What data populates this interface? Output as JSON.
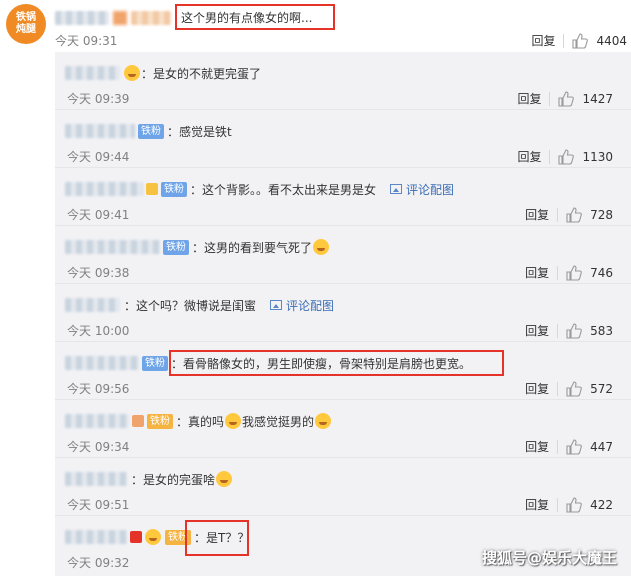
{
  "main_comment": {
    "avatar_text_line1": "铁锅",
    "avatar_text_line2": "炖腿",
    "text": "这个男的有点像女的啊...",
    "time": "今天 09:31",
    "reply_label": "回复",
    "likes": "4404"
  },
  "replies": [
    {
      "badge": "",
      "text": "是女的不就更完蛋了",
      "time": "今天 09:39",
      "reply_label": "回复",
      "likes": "1427"
    },
    {
      "badge": "铁粉",
      "text": "感觉是铁t",
      "time": "今天 09:44",
      "reply_label": "回复",
      "likes": "1130"
    },
    {
      "badge": "铁粉",
      "text": "这个背影。。看不太出来是男是女",
      "pic_link": "评论配图",
      "time": "今天 09:41",
      "reply_label": "回复",
      "likes": "728"
    },
    {
      "badge": "铁粉",
      "text": "这男的看到要气死了",
      "time": "今天 09:38",
      "reply_label": "回复",
      "likes": "746"
    },
    {
      "badge": "",
      "text": "这个吗？微博说是闺蜜",
      "pic_link": "评论配图",
      "time": "今天 10:00",
      "reply_label": "回复",
      "likes": "583"
    },
    {
      "badge": "铁粉",
      "text": "看骨骼像女的，男生即使瘦，骨架特别是肩膀也更宽。",
      "time": "今天 09:56",
      "reply_label": "回复",
      "likes": "572"
    },
    {
      "badge": "铁粉",
      "text_a": "真的吗",
      "text_b": "我感觉挺男的",
      "time": "今天 09:34",
      "reply_label": "回复",
      "likes": "447"
    },
    {
      "badge": "",
      "text": "是女的完蛋啥",
      "time": "今天 09:51",
      "reply_label": "回复",
      "likes": "422"
    },
    {
      "badge": "铁粉",
      "text": "是T？？",
      "time": "今天 09:32",
      "reply_label": "回复",
      "likes": ""
    }
  ],
  "watermark": "搜狐号@娱乐大魔王",
  "colors": {
    "highlight_box": "#e5332a",
    "badge": "#6fa5e8",
    "reply_bg": "#f2f2f5",
    "link": "#3b6db5"
  }
}
